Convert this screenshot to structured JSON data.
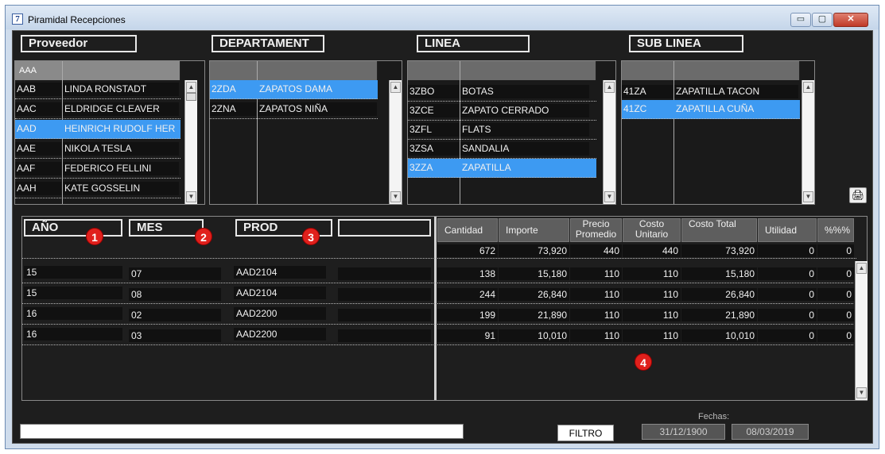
{
  "window": {
    "title": "Piramidal Recepciones",
    "app_icon": "7",
    "minimize_label": "▭",
    "maximize_label": "▢",
    "close_label": "✕"
  },
  "filters": {
    "proveedor": {
      "header": "Proveedor",
      "filter_code": "AAA",
      "rows": [
        {
          "code": "AAB",
          "name": "LINDA RONSTADT",
          "selected": false
        },
        {
          "code": "AAC",
          "name": "ELDRIDGE CLEAVER",
          "selected": false
        },
        {
          "code": "AAD",
          "name": "HEINRICH RUDOLF HER",
          "selected": true
        },
        {
          "code": "AAE",
          "name": "NIKOLA TESLA",
          "selected": false
        },
        {
          "code": "AAF",
          "name": "FEDERICO FELLINI",
          "selected": false
        },
        {
          "code": "AAH",
          "name": "KATE GOSSELIN",
          "selected": false
        }
      ]
    },
    "departament": {
      "header": "DEPARTAMENT",
      "rows": [
        {
          "code": "2ZDA",
          "name": "ZAPATOS DAMA",
          "selected": true
        },
        {
          "code": "2ZNA",
          "name": "ZAPATOS NIÑA",
          "selected": false
        }
      ]
    },
    "linea": {
      "header": "LINEA",
      "rows": [
        {
          "code": "3ZBO",
          "name": "BOTAS",
          "selected": false
        },
        {
          "code": "3ZCE",
          "name": "ZAPATO CERRADO",
          "selected": false
        },
        {
          "code": "3ZFL",
          "name": "FLATS",
          "selected": false
        },
        {
          "code": "3ZSA",
          "name": "SANDALIA",
          "selected": false
        },
        {
          "code": "3ZZA",
          "name": "ZAPATILLA",
          "selected": true
        }
      ]
    },
    "sublinea": {
      "header": "SUB LINEA",
      "rows": [
        {
          "code": "41ZA",
          "name": "ZAPATILLA TACON",
          "selected": false
        },
        {
          "code": "41ZC",
          "name": "ZAPATILLA CUÑA",
          "selected": true
        }
      ]
    }
  },
  "grid": {
    "group_headers": [
      "AÑO",
      "MES",
      "PROD",
      ""
    ],
    "badges": [
      "1",
      "2",
      "3",
      "4"
    ],
    "columns": [
      "Cantidad",
      "Importe",
      "Precio Promedio",
      "Costo Unitario",
      "Costo Total",
      "Utilidad",
      "%%%"
    ],
    "totals": [
      "672",
      "73,920",
      "440",
      "440",
      "73,920",
      "0",
      "0"
    ],
    "rows": [
      {
        "ano": "15",
        "mes": "07",
        "prod": "AAD2104",
        "extra": "",
        "values": [
          "138",
          "15,180",
          "110",
          "110",
          "15,180",
          "0",
          "0"
        ]
      },
      {
        "ano": "15",
        "mes": "08",
        "prod": "AAD2104",
        "extra": "",
        "values": [
          "244",
          "26,840",
          "110",
          "110",
          "26,840",
          "0",
          "0"
        ]
      },
      {
        "ano": "16",
        "mes": "02",
        "prod": "AAD2200",
        "extra": "",
        "values": [
          "199",
          "21,890",
          "110",
          "110",
          "21,890",
          "0",
          "0"
        ]
      },
      {
        "ano": "16",
        "mes": "03",
        "prod": "AAD2200",
        "extra": "",
        "values": [
          "91",
          "10,010",
          "110",
          "110",
          "10,010",
          "0",
          "0"
        ]
      }
    ]
  },
  "footer": {
    "status_value": "",
    "filtro_label": "FILTRO",
    "fechas_label": "Fechas:",
    "date_from": "31/12/1900",
    "date_to": "08/03/2019"
  },
  "icons": {
    "printer": "printer-icon",
    "scroll_up": "scroll-up-icon",
    "scroll_down": "scroll-down-icon"
  },
  "colors": {
    "selection": "#3d9af2",
    "background": "#1e1e1e",
    "badge": "#e0201c"
  }
}
